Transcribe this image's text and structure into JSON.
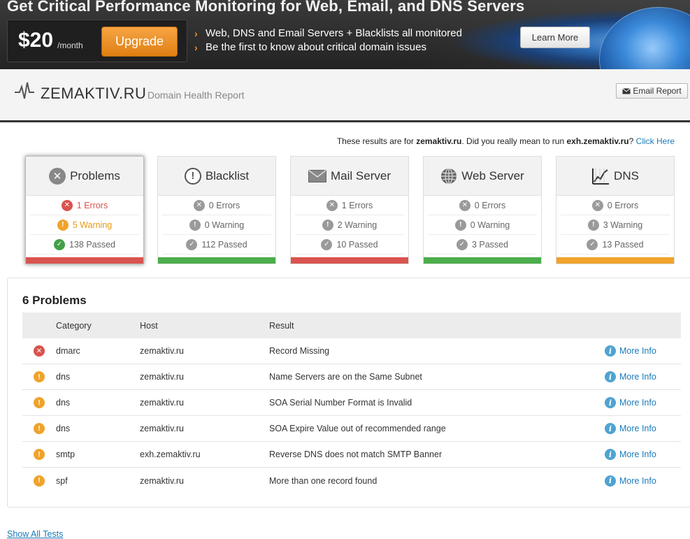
{
  "banner": {
    "title": "Get Critical Performance Monitoring for Web, Email, and DNS Servers",
    "price": "$20",
    "price_unit": "/month",
    "upgrade_label": "Upgrade",
    "bullets": [
      "Web, DNS and Email Servers + Blacklists all monitored",
      "Be the first to know about critical domain issues"
    ],
    "learn_more_label": "Learn More"
  },
  "header": {
    "logo_name": "ZEMAKTIV.RU",
    "logo_subtitle": "Domain Health Report",
    "email_report_label": "Email Report"
  },
  "results_line": {
    "prefix": "These results are for",
    "domain": "zemaktiv.ru",
    "middle": ". Did you really mean to run",
    "suggested": "exh.zemaktiv.ru",
    "suffix": "?",
    "link": "Click Here"
  },
  "cards": [
    {
      "title": "Problems",
      "icon": "x-circle-icon",
      "errors": "1 Errors",
      "warning": "5 Warning",
      "passed": "138 Passed",
      "status_color": "#d9534f"
    },
    {
      "title": "Blacklist",
      "icon": "exclamation-circle-icon",
      "errors": "0 Errors",
      "warning": "0 Warning",
      "passed": "112 Passed",
      "status_color": "#4cae4c"
    },
    {
      "title": "Mail Server",
      "icon": "envelope-icon",
      "errors": "1 Errors",
      "warning": "2 Warning",
      "passed": "10 Passed",
      "status_color": "#d9534f"
    },
    {
      "title": "Web Server",
      "icon": "globe-icon",
      "errors": "0 Errors",
      "warning": "0 Warning",
      "passed": "3 Passed",
      "status_color": "#4cae4c"
    },
    {
      "title": "DNS",
      "icon": "chart-icon",
      "errors": "0 Errors",
      "warning": "3 Warning",
      "passed": "13 Passed",
      "status_color": "#f0a32b"
    }
  ],
  "problems": {
    "title": "6 Problems",
    "headers": [
      "Category",
      "Host",
      "Result"
    ],
    "more_info_label": "More Info",
    "rows": [
      {
        "severity": "error",
        "category": "dmarc",
        "host": "zemaktiv.ru",
        "result": "Record Missing"
      },
      {
        "severity": "warning",
        "category": "dns",
        "host": "zemaktiv.ru",
        "result": "Name Servers are on the Same Subnet"
      },
      {
        "severity": "warning",
        "category": "dns",
        "host": "zemaktiv.ru",
        "result": "SOA Serial Number Format is Invalid"
      },
      {
        "severity": "warning",
        "category": "dns",
        "host": "zemaktiv.ru",
        "result": "SOA Expire Value out of recommended range"
      },
      {
        "severity": "warning",
        "category": "smtp",
        "host": "exh.zemaktiv.ru",
        "result": "Reverse DNS does not match SMTP Banner"
      },
      {
        "severity": "warning",
        "category": "spf",
        "host": "zemaktiv.ru",
        "result": "More than one record found"
      }
    ]
  },
  "show_all_label": "Show All Tests"
}
